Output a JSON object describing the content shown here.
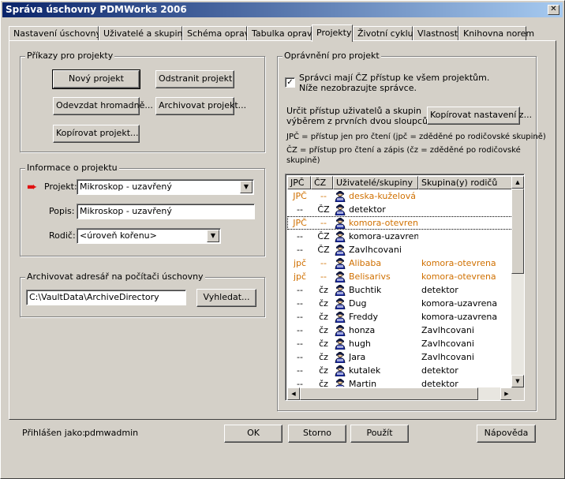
{
  "window": {
    "title": "Správa úschovny PDMWorks 2006",
    "close_glyph": "✕"
  },
  "tabs": [
    {
      "label": "Nastavení úschovny"
    },
    {
      "label": "Uživatelé a skupiny"
    },
    {
      "label": "Schéma oprav"
    },
    {
      "label": "Tabulka oprav"
    },
    {
      "label": "Projekty"
    },
    {
      "label": "Životní cyklus"
    },
    {
      "label": "Vlastnosti"
    },
    {
      "label": "Knihovna norem"
    }
  ],
  "commands": {
    "title": "Příkazy pro projekty",
    "new_project": "Nový projekt",
    "delete_project": "Odstranit projekt",
    "bulk_return": "Odevzdat hromadně...",
    "archive_project": "Archivovat projekt...",
    "copy_project": "Kopírovat projekt..."
  },
  "project_info": {
    "title": "Informace o projektu",
    "project_label": "Projekt:",
    "project_value": "Mikroskop - uzavřený",
    "description_label": "Popis:",
    "description_value": "Mikroskop - uzavřený",
    "parent_label": "Rodič:",
    "parent_value": "<úroveň kořenu>"
  },
  "archive": {
    "title": "Archivovat adresář na počítači úschovny",
    "path": "C:\\VaultData\\ArchiveDirectory",
    "browse": "Vyhledat..."
  },
  "permissions": {
    "title": "Oprávnění pro projekt",
    "admins_checkbox_line1": "Správci mají ČZ přístup ke všem projektům.",
    "admins_checkbox_line2": "Níže nezobrazujte správce.",
    "checkbox_mark": "✓",
    "access_text_line1": "Určit přístup uživatelů a skupin",
    "access_text_line2": "výběrem z prvních dvou sloupců",
    "copy_settings": "Kopírovat nastavení z...",
    "legend_jpc": "JPČ = přístup jen pro čtení (jpč = zděděné po rodičovské skupině)",
    "legend_cz_line1": "ČZ = přístup pro čtení a zápis (čz = zděděné po rodičovské",
    "legend_cz_line2": "skupině)",
    "columns": [
      "JPČ",
      "ČZ",
      "Uživatelé/skupiny",
      "Skupina(y) rodičů"
    ],
    "rows": [
      {
        "jpc": "JPČ",
        "cz": "--",
        "name": "deska-kuželová",
        "parent": "",
        "inherited": true
      },
      {
        "jpc": "--",
        "cz": "ČZ",
        "name": "detektor",
        "parent": "",
        "inherited": false
      },
      {
        "jpc": "JPČ",
        "cz": "--",
        "name": "komora-otevrena",
        "parent": "",
        "inherited": true
      },
      {
        "jpc": "--",
        "cz": "ČZ",
        "name": "komora-uzavrena",
        "parent": "",
        "inherited": false
      },
      {
        "jpc": "--",
        "cz": "ČZ",
        "name": "Zavlhcovani",
        "parent": "",
        "inherited": false
      },
      {
        "jpc": "jpč",
        "cz": "--",
        "name": "Alibaba",
        "parent": "komora-otevrena",
        "inherited": true
      },
      {
        "jpc": "jpč",
        "cz": "--",
        "name": "Belisarivs",
        "parent": "komora-otevrena",
        "inherited": true
      },
      {
        "jpc": "--",
        "cz": "čz",
        "name": "Buchtik",
        "parent": "detektor",
        "inherited": false
      },
      {
        "jpc": "--",
        "cz": "čz",
        "name": "Dug",
        "parent": "komora-uzavrena",
        "inherited": false
      },
      {
        "jpc": "--",
        "cz": "čz",
        "name": "Freddy",
        "parent": "komora-uzavrena",
        "inherited": false
      },
      {
        "jpc": "--",
        "cz": "čz",
        "name": "honza",
        "parent": "Zavlhcovani",
        "inherited": false
      },
      {
        "jpc": "--",
        "cz": "čz",
        "name": "hugh",
        "parent": "Zavlhcovani",
        "inherited": false
      },
      {
        "jpc": "--",
        "cz": "čz",
        "name": "Jara",
        "parent": "Zavlhcovani",
        "inherited": false
      },
      {
        "jpc": "--",
        "cz": "čz",
        "name": "kutalek",
        "parent": "detektor",
        "inherited": false
      },
      {
        "jpc": "--",
        "cz": "čz",
        "name": "Martin",
        "parent": "detektor",
        "inherited": false
      }
    ],
    "focused_row": 2,
    "inherited_color": "#d07000"
  },
  "footer": {
    "logged_in_label": "Přihlášen jako:",
    "username": "pdmwadmin",
    "ok": "OK",
    "cancel": "Storno",
    "apply": "Použít",
    "help": "Nápověda"
  },
  "icons": {
    "arrow": "➨",
    "scroll_up": "▲",
    "scroll_down": "▼",
    "scroll_left": "◀",
    "scroll_right": "▶",
    "dropdown": "▼"
  }
}
